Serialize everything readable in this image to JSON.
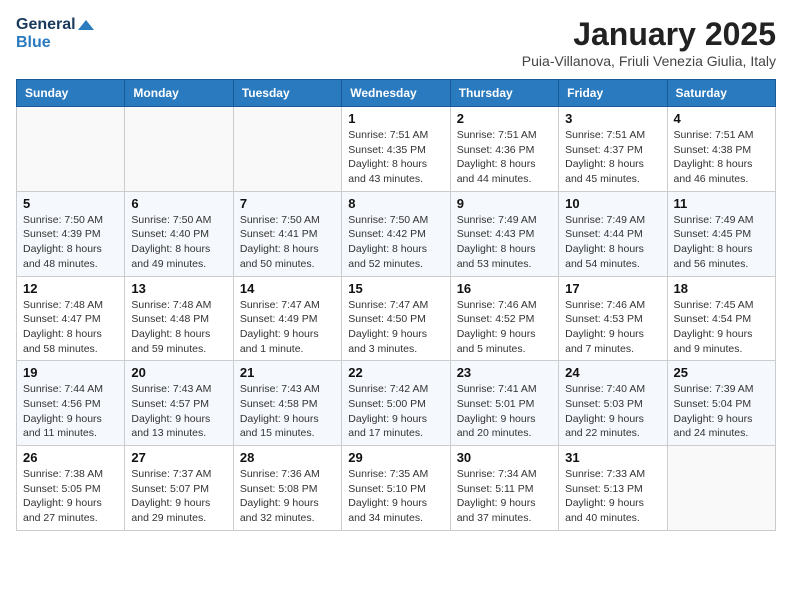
{
  "header": {
    "logo_line1": "General",
    "logo_line2": "Blue",
    "month_title": "January 2025",
    "subtitle": "Puia-Villanova, Friuli Venezia Giulia, Italy"
  },
  "weekdays": [
    "Sunday",
    "Monday",
    "Tuesday",
    "Wednesday",
    "Thursday",
    "Friday",
    "Saturday"
  ],
  "weeks": [
    [
      {
        "day": "",
        "info": ""
      },
      {
        "day": "",
        "info": ""
      },
      {
        "day": "",
        "info": ""
      },
      {
        "day": "1",
        "info": "Sunrise: 7:51 AM\nSunset: 4:35 PM\nDaylight: 8 hours\nand 43 minutes."
      },
      {
        "day": "2",
        "info": "Sunrise: 7:51 AM\nSunset: 4:36 PM\nDaylight: 8 hours\nand 44 minutes."
      },
      {
        "day": "3",
        "info": "Sunrise: 7:51 AM\nSunset: 4:37 PM\nDaylight: 8 hours\nand 45 minutes."
      },
      {
        "day": "4",
        "info": "Sunrise: 7:51 AM\nSunset: 4:38 PM\nDaylight: 8 hours\nand 46 minutes."
      }
    ],
    [
      {
        "day": "5",
        "info": "Sunrise: 7:50 AM\nSunset: 4:39 PM\nDaylight: 8 hours\nand 48 minutes."
      },
      {
        "day": "6",
        "info": "Sunrise: 7:50 AM\nSunset: 4:40 PM\nDaylight: 8 hours\nand 49 minutes."
      },
      {
        "day": "7",
        "info": "Sunrise: 7:50 AM\nSunset: 4:41 PM\nDaylight: 8 hours\nand 50 minutes."
      },
      {
        "day": "8",
        "info": "Sunrise: 7:50 AM\nSunset: 4:42 PM\nDaylight: 8 hours\nand 52 minutes."
      },
      {
        "day": "9",
        "info": "Sunrise: 7:49 AM\nSunset: 4:43 PM\nDaylight: 8 hours\nand 53 minutes."
      },
      {
        "day": "10",
        "info": "Sunrise: 7:49 AM\nSunset: 4:44 PM\nDaylight: 8 hours\nand 54 minutes."
      },
      {
        "day": "11",
        "info": "Sunrise: 7:49 AM\nSunset: 4:45 PM\nDaylight: 8 hours\nand 56 minutes."
      }
    ],
    [
      {
        "day": "12",
        "info": "Sunrise: 7:48 AM\nSunset: 4:47 PM\nDaylight: 8 hours\nand 58 minutes."
      },
      {
        "day": "13",
        "info": "Sunrise: 7:48 AM\nSunset: 4:48 PM\nDaylight: 8 hours\nand 59 minutes."
      },
      {
        "day": "14",
        "info": "Sunrise: 7:47 AM\nSunset: 4:49 PM\nDaylight: 9 hours\nand 1 minute."
      },
      {
        "day": "15",
        "info": "Sunrise: 7:47 AM\nSunset: 4:50 PM\nDaylight: 9 hours\nand 3 minutes."
      },
      {
        "day": "16",
        "info": "Sunrise: 7:46 AM\nSunset: 4:52 PM\nDaylight: 9 hours\nand 5 minutes."
      },
      {
        "day": "17",
        "info": "Sunrise: 7:46 AM\nSunset: 4:53 PM\nDaylight: 9 hours\nand 7 minutes."
      },
      {
        "day": "18",
        "info": "Sunrise: 7:45 AM\nSunset: 4:54 PM\nDaylight: 9 hours\nand 9 minutes."
      }
    ],
    [
      {
        "day": "19",
        "info": "Sunrise: 7:44 AM\nSunset: 4:56 PM\nDaylight: 9 hours\nand 11 minutes."
      },
      {
        "day": "20",
        "info": "Sunrise: 7:43 AM\nSunset: 4:57 PM\nDaylight: 9 hours\nand 13 minutes."
      },
      {
        "day": "21",
        "info": "Sunrise: 7:43 AM\nSunset: 4:58 PM\nDaylight: 9 hours\nand 15 minutes."
      },
      {
        "day": "22",
        "info": "Sunrise: 7:42 AM\nSunset: 5:00 PM\nDaylight: 9 hours\nand 17 minutes."
      },
      {
        "day": "23",
        "info": "Sunrise: 7:41 AM\nSunset: 5:01 PM\nDaylight: 9 hours\nand 20 minutes."
      },
      {
        "day": "24",
        "info": "Sunrise: 7:40 AM\nSunset: 5:03 PM\nDaylight: 9 hours\nand 22 minutes."
      },
      {
        "day": "25",
        "info": "Sunrise: 7:39 AM\nSunset: 5:04 PM\nDaylight: 9 hours\nand 24 minutes."
      }
    ],
    [
      {
        "day": "26",
        "info": "Sunrise: 7:38 AM\nSunset: 5:05 PM\nDaylight: 9 hours\nand 27 minutes."
      },
      {
        "day": "27",
        "info": "Sunrise: 7:37 AM\nSunset: 5:07 PM\nDaylight: 9 hours\nand 29 minutes."
      },
      {
        "day": "28",
        "info": "Sunrise: 7:36 AM\nSunset: 5:08 PM\nDaylight: 9 hours\nand 32 minutes."
      },
      {
        "day": "29",
        "info": "Sunrise: 7:35 AM\nSunset: 5:10 PM\nDaylight: 9 hours\nand 34 minutes."
      },
      {
        "day": "30",
        "info": "Sunrise: 7:34 AM\nSunset: 5:11 PM\nDaylight: 9 hours\nand 37 minutes."
      },
      {
        "day": "31",
        "info": "Sunrise: 7:33 AM\nSunset: 5:13 PM\nDaylight: 9 hours\nand 40 minutes."
      },
      {
        "day": "",
        "info": ""
      }
    ]
  ]
}
